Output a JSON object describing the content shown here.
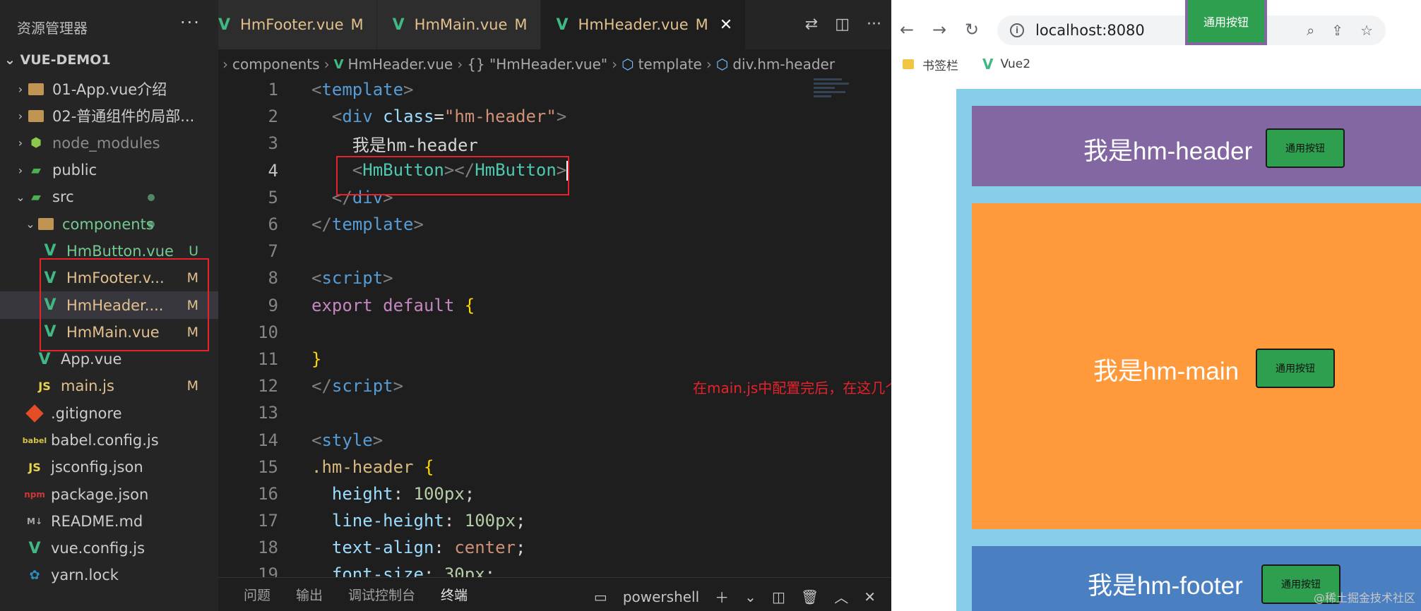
{
  "sidebar": {
    "title": "资源管理器",
    "more": "···",
    "project": "VUE-DEMO1",
    "items": [
      {
        "label": "01-App.vue介绍",
        "chev": "›",
        "icon": "folder",
        "cls": "",
        "badge": ""
      },
      {
        "label": "02-普通组件的局部...",
        "chev": "›",
        "icon": "folder",
        "cls": "",
        "badge": ""
      },
      {
        "label": "node_modules",
        "chev": "›",
        "icon": "node",
        "cls": "label-grey",
        "badge": ""
      },
      {
        "label": "public",
        "chev": "›",
        "icon": "public",
        "cls": "",
        "badge": ""
      },
      {
        "label": "src",
        "chev": "⌄",
        "icon": "src",
        "cls": "",
        "badge": ""
      },
      {
        "label": "components",
        "chev": "⌄",
        "icon": "folder-open",
        "cls": "label-green",
        "badge": ""
      },
      {
        "label": "HmButton.vue",
        "chev": "",
        "icon": "vue",
        "cls": "label-green",
        "badge": "U"
      },
      {
        "label": "HmFooter.v...",
        "chev": "",
        "icon": "vue",
        "cls": "label-mod",
        "badge": "M"
      },
      {
        "label": "HmHeader....",
        "chev": "",
        "icon": "vue",
        "cls": "label-mod",
        "badge": "M"
      },
      {
        "label": "HmMain.vue",
        "chev": "",
        "icon": "vue",
        "cls": "label-mod",
        "badge": "M"
      },
      {
        "label": "App.vue",
        "chev": "",
        "icon": "vue",
        "cls": "",
        "badge": ""
      },
      {
        "label": "main.js",
        "chev": "",
        "icon": "js",
        "cls": "label-mod",
        "badge": "M"
      },
      {
        "label": ".gitignore",
        "chev": "",
        "icon": "git",
        "cls": "",
        "badge": ""
      },
      {
        "label": "babel.config.js",
        "chev": "",
        "icon": "babel",
        "cls": "",
        "badge": ""
      },
      {
        "label": "jsconfig.json",
        "chev": "",
        "icon": "js",
        "cls": "",
        "badge": ""
      },
      {
        "label": "package.json",
        "chev": "",
        "icon": "npm",
        "cls": "",
        "badge": ""
      },
      {
        "label": "README.md",
        "chev": "",
        "icon": "md",
        "cls": "",
        "badge": ""
      },
      {
        "label": "vue.config.js",
        "chev": "",
        "icon": "vue",
        "cls": "",
        "badge": ""
      },
      {
        "label": "yarn.lock",
        "chev": "",
        "icon": "yarn",
        "cls": "",
        "badge": ""
      }
    ]
  },
  "tabs": [
    {
      "name": "HmFooter.vue",
      "mod": "M"
    },
    {
      "name": "HmMain.vue",
      "mod": "M"
    },
    {
      "name": "HmHeader.vue",
      "mod": "M"
    }
  ],
  "breadcrumb": {
    "components": "components",
    "file": "HmHeader.vue",
    "obj": "{} \"HmHeader.vue\"",
    "template": "template",
    "div": "div.hm-header"
  },
  "code": {
    "line_numbers": [
      "1",
      "2",
      "3",
      "4",
      "5",
      "6",
      "7",
      "8",
      "9",
      "10",
      "11",
      "12",
      "13",
      "14",
      "15",
      "16",
      "17",
      "18",
      "19"
    ],
    "l1": "template",
    "l2_tag": "div",
    "l2_attr": "class",
    "l2_val": "\"hm-header\"",
    "l3": "我是hm-header",
    "l4_open": "HmButton",
    "l4_close": "HmButton",
    "l5": "div",
    "l6": "template",
    "l8": "script",
    "l9_kw": "export default",
    "l9_brace": "{",
    "l11_brace": "}",
    "l12": "script",
    "l14": "style",
    "l15_sel": ".hm-header",
    "l15_brace": "{",
    "l16_prop": "height",
    "l16_val": "100px",
    "l17_prop": "line-height",
    "l17_val": "100px",
    "l18_prop": "text-align",
    "l18_val": "center",
    "l19_prop": "font-size",
    "l19_val": "30px"
  },
  "note": "在main.js中配置完后，在这几个组件中都能使用这个按钮组件",
  "panel": {
    "tabs": [
      "问题",
      "输出",
      "调试控制台",
      "终端"
    ],
    "shell": "powershell"
  },
  "browser": {
    "url": "localhost:8080",
    "bookmarks": [
      "书签栏",
      "Vue2"
    ],
    "floating_button": "通用按钮",
    "header_text": "我是hm-header",
    "main_text": "我是hm-main",
    "footer_text": "我是hm-footer",
    "button_label": "通用按钮",
    "watermark": "@稀土掘金技术社区"
  }
}
